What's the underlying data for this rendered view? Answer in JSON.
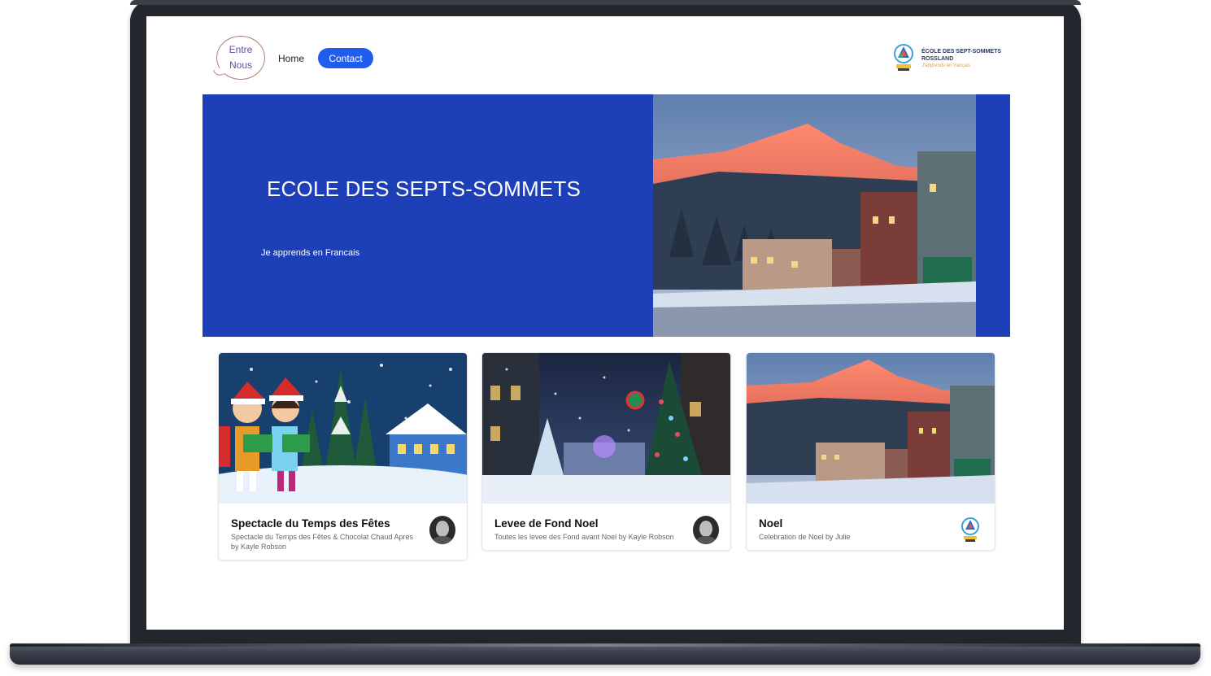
{
  "nav": {
    "logo_line1": "Entre",
    "logo_line2": "Nous",
    "home_label": "Home",
    "contact_label": "Contact"
  },
  "school": {
    "name_line1": "ÉCOLE DES SEPT-SOMMETS",
    "name_line2": "ROSSLAND",
    "tagline": "J'apprends en français"
  },
  "hero": {
    "title": "ECOLE DES SEPTS-SOMMETS",
    "subtitle": "Je apprends en Francais"
  },
  "cards": [
    {
      "title": "Spectacle du Temps des Fêtes",
      "description": "Spectacle du Temps des Fêtes & Chocolat Chaud Apres by Kayle Robson"
    },
    {
      "title": "Levee de Fond Noel",
      "description": "Toutes les levee des Fond avant Noel by Kayle Robson"
    },
    {
      "title": "Noel",
      "description": "Celebration de Noel by Julie"
    }
  ],
  "colors": {
    "hero_blue": "#1d40b8",
    "contact_button": "#1f5cf0",
    "laptop_frame": "#23262d"
  }
}
